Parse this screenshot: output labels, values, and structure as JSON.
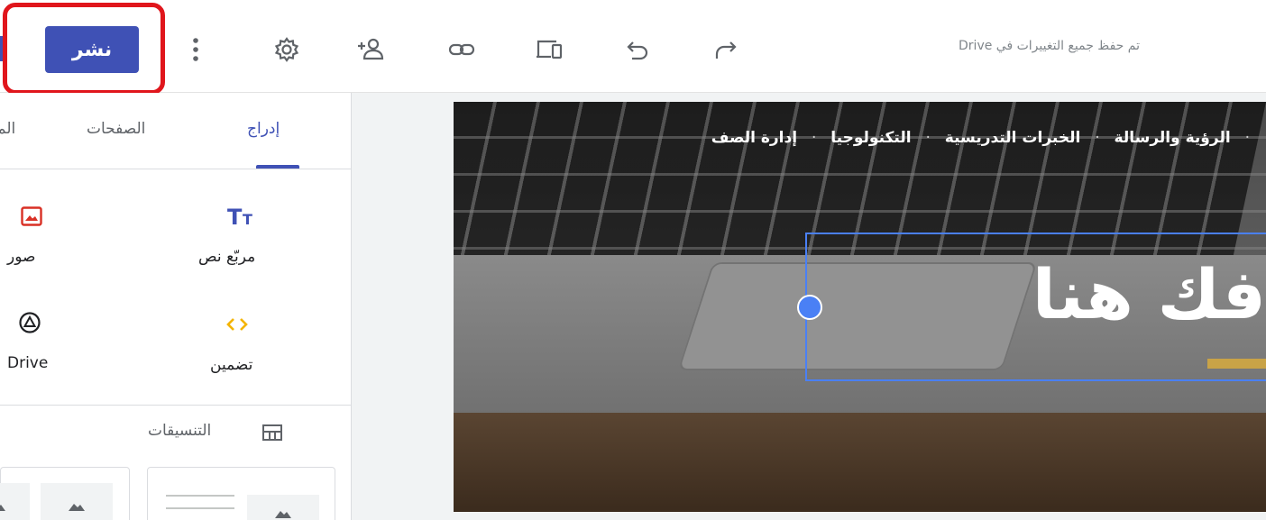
{
  "toolbar": {
    "publish_label": "نشر",
    "save_status": "تم حفظ جميع التغييرات في Drive",
    "icons": [
      "more-vert-icon",
      "settings-icon",
      "share-person-add-icon",
      "link-icon",
      "preview-devices-icon",
      "undo-icon",
      "redo-icon"
    ]
  },
  "panel": {
    "tabs": [
      {
        "label": "إدراج",
        "active": true
      },
      {
        "label": "الصفحات",
        "active": false
      },
      {
        "label": "الم",
        "active": false
      }
    ],
    "insert_items": [
      {
        "label": "مربّع نص",
        "icon": "text-box-icon"
      },
      {
        "label": "صور",
        "icon": "image-icon"
      },
      {
        "label": "تضمين",
        "icon": "embed-icon"
      },
      {
        "label": "Drive",
        "icon": "drive-icon"
      }
    ],
    "layouts_title": "التنسيقات"
  },
  "canvas": {
    "nav_links": [
      "الرؤية والرسالة",
      "الخبرات التدريسية",
      "التكنولوجيا",
      "إدارة الصف"
    ],
    "hero_title": "فك هنا"
  },
  "colors": {
    "accent": "#3f51b5",
    "highlight": "#e0161c",
    "selection": "#4a80f5",
    "hero_accent": "#c9a347"
  }
}
